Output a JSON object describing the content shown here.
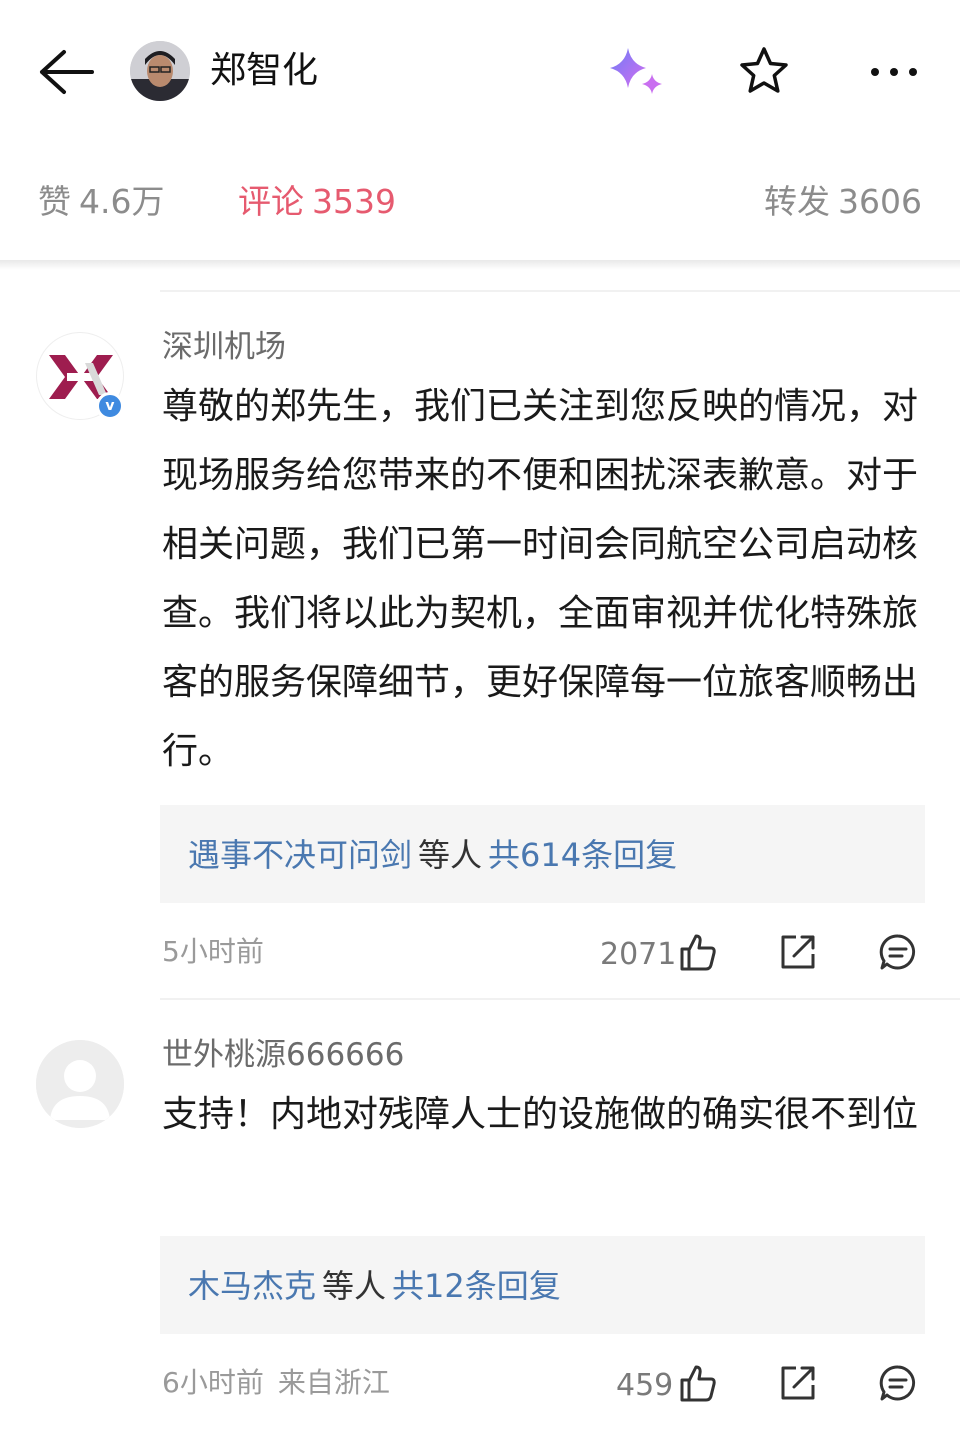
{
  "header": {
    "back_icon": "arrow-left-icon",
    "author_name": "郑智化",
    "ai_icon": "sparkle-icon",
    "favorite_icon": "star-icon",
    "more_icon": "more-horizontal-icon"
  },
  "stats": {
    "likes_label": "赞",
    "likes_value": "4.6万",
    "comments_label": "评论",
    "comments_value": "3539",
    "reposts_label": "转发",
    "reposts_value": "3606",
    "active_color": "#e65a6f"
  },
  "comments": [
    {
      "user": "深圳机场",
      "verified": true,
      "text": "尊敬的郑先生，我们已关注到您反映的情况，对现场服务给您带来的不便和困扰深表歉意。对于相关问题，我们已第一时间会同航空公司启动核查。我们将以此为契机，全面审视并优化特殊旅客的服务保障细节，更好保障每一位旅客顺畅出行。",
      "reply_user": "遇事不决可问剑",
      "reply_mid": "等人",
      "reply_count": "共614条回复",
      "time": "5小时前",
      "location": "",
      "likes": "2071"
    },
    {
      "user": "世外桃源666666",
      "verified": false,
      "text": "支持！内地对残障人士的设施做的确实很不到位",
      "reply_user": "木马杰克",
      "reply_mid": "等人",
      "reply_count": "共12条回复",
      "time": "6小时前",
      "location": "来自浙江",
      "likes": "459"
    }
  ],
  "colors": {
    "link": "#4a78b0",
    "muted": "#9a9a9a",
    "reply_bg": "#f5f5f5"
  }
}
